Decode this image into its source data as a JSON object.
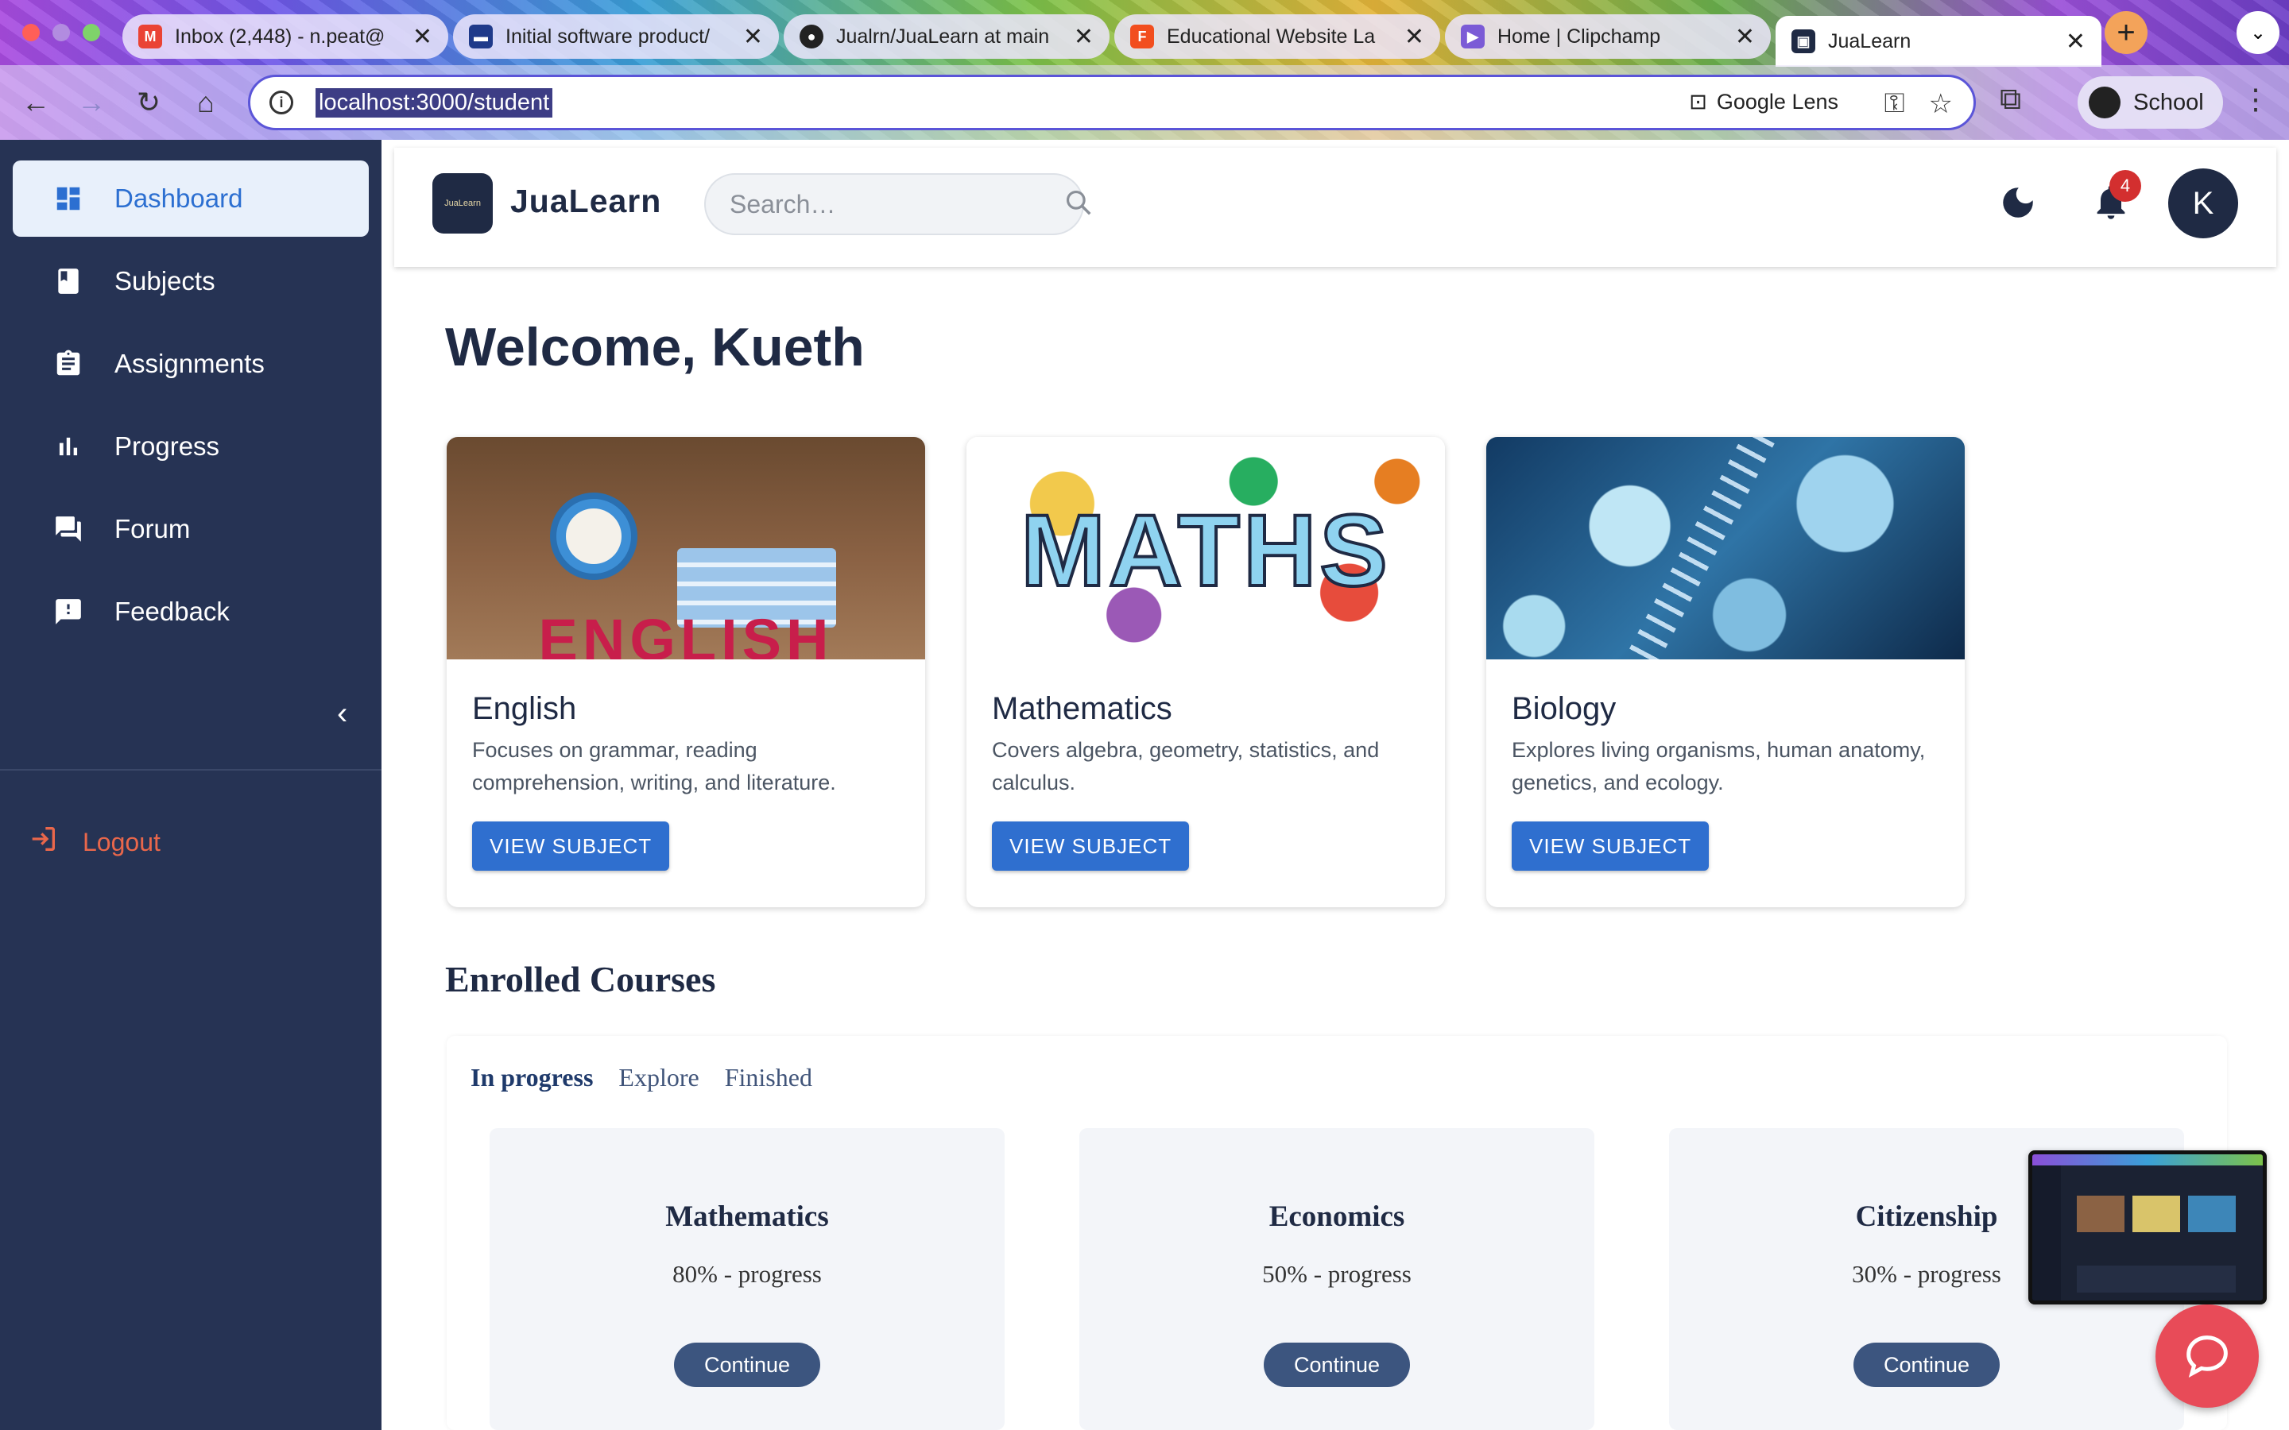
{
  "browser": {
    "tabs": [
      {
        "label": "Inbox (2,448) - n.peat@",
        "favicon": "gmail-icon",
        "color": "#ea4335",
        "active": false
      },
      {
        "label": "Initial software product/",
        "favicon": "docs-icon",
        "color": "#1f3a8a",
        "active": false
      },
      {
        "label": "Jualrn/JuaLearn at main",
        "favicon": "github-icon",
        "color": "#222222",
        "active": false
      },
      {
        "label": "Educational Website La",
        "favicon": "figma-icon",
        "color": "#f24e1e",
        "active": false
      },
      {
        "label": "Home | Clipchamp",
        "favicon": "clipchamp-icon",
        "color": "#7b5bd6",
        "active": false
      },
      {
        "label": "JuaLearn",
        "favicon": "jualearn-icon",
        "color": "#1f2a44",
        "active": true
      }
    ],
    "close_glyph": "✕",
    "new_tab_glyph": "+",
    "url": "localhost:3000/student",
    "lens_label": "Google Lens",
    "profile_label": "School"
  },
  "sidebar": {
    "items": [
      {
        "label": "Dashboard",
        "icon": "dashboard-icon",
        "active": true
      },
      {
        "label": "Subjects",
        "icon": "book-icon",
        "active": false
      },
      {
        "label": "Assignments",
        "icon": "clipboard-icon",
        "active": false
      },
      {
        "label": "Progress",
        "icon": "bar-chart-icon",
        "active": false
      },
      {
        "label": "Forum",
        "icon": "forum-icon",
        "active": false
      },
      {
        "label": "Feedback",
        "icon": "feedback-icon",
        "active": false
      }
    ],
    "logout_label": "Logout"
  },
  "header": {
    "brand": "JuaLearn",
    "logo_text": "JuaLearn",
    "search_placeholder": "Search…",
    "notification_count": "4",
    "avatar_initial": "K"
  },
  "main": {
    "welcome": "Welcome, Kueth",
    "subjects": [
      {
        "title": "English",
        "description": "Focuses on grammar, reading comprehension, writing, and literature.",
        "button": "VIEW SUBJECT",
        "image_text": "ENGLISH"
      },
      {
        "title": "Mathematics",
        "description": "Covers algebra, geometry, statistics, and calculus.",
        "button": "VIEW SUBJECT",
        "image_text": "MATHS"
      },
      {
        "title": "Biology",
        "description": "Explores living organisms, human anatomy, genetics, and ecology.",
        "button": "VIEW SUBJECT",
        "image_text": ""
      }
    ],
    "enrolled_title": "Enrolled Courses",
    "enrolled_tabs": [
      "In progress",
      "Explore",
      "Finished"
    ],
    "courses": [
      {
        "name": "Mathematics",
        "progress": "80% - progress",
        "button": "Continue"
      },
      {
        "name": "Economics",
        "progress": "50% - progress",
        "button": "Continue"
      },
      {
        "name": "Citizenship",
        "progress": "30% - progress",
        "button": "Continue"
      }
    ]
  },
  "colors": {
    "sidebar_bg": "#263354",
    "active_item_bg": "#e8f0fb",
    "accent": "#2f6fcf",
    "logout": "#e9674b",
    "badge": "#d32f2f",
    "chat_fab": "#e84b58"
  }
}
